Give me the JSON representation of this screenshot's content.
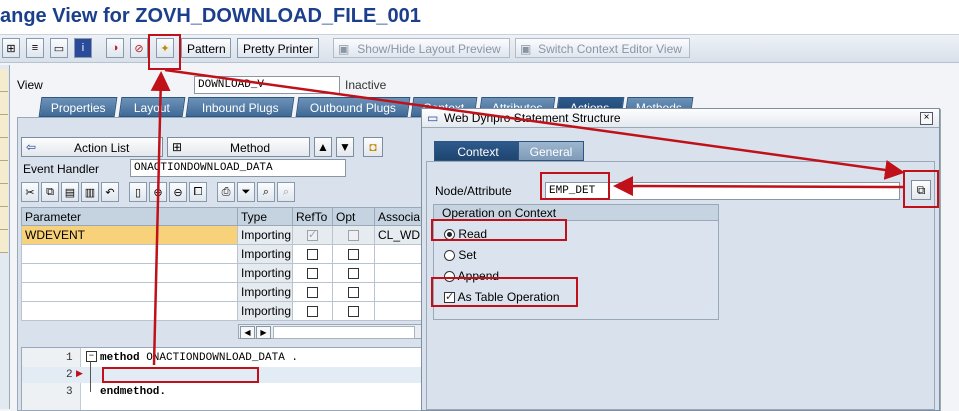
{
  "window_title": "ange View for ZOVH_DOWNLOAD_FILE_001",
  "toolbar": {
    "pattern": "Pattern",
    "pretty_printer": "Pretty Printer",
    "show_hide_layout": "Show/Hide Layout Preview",
    "switch_context": "Switch Context Editor View"
  },
  "view": {
    "label": "View",
    "value": "DOWNLOAD_V",
    "status": "Inactive"
  },
  "main_tabs": [
    "Properties",
    "Layout",
    "Inbound Plugs",
    "Outbound Plugs",
    "Context",
    "Attributes",
    "Actions",
    "Methods"
  ],
  "method_bar": {
    "action_list": "Action List",
    "method": "Method"
  },
  "event_handler": {
    "label": "Event Handler",
    "value": "ONACTIONDOWNLOAD_DATA"
  },
  "param_table": {
    "headers": [
      "Parameter",
      "Type",
      "RefTo",
      "Opt",
      "Associa"
    ],
    "rows": [
      {
        "parameter": "WDEVENT",
        "type": "Importing",
        "refto": true,
        "opt": false,
        "assoc": "CL_WD"
      },
      {
        "parameter": "",
        "type": "Importing",
        "refto": false,
        "opt": false,
        "assoc": ""
      },
      {
        "parameter": "",
        "type": "Importing",
        "refto": false,
        "opt": false,
        "assoc": ""
      },
      {
        "parameter": "",
        "type": "Importing",
        "refto": false,
        "opt": false,
        "assoc": ""
      },
      {
        "parameter": "",
        "type": "Importing",
        "refto": false,
        "opt": false,
        "assoc": ""
      }
    ]
  },
  "code": {
    "lines": [
      {
        "num": "1",
        "keyword": "method",
        "text": " ONACTIONDOWNLOAD_DATA ."
      },
      {
        "num": "2",
        "keyword": "",
        "text": ""
      },
      {
        "num": "3",
        "keyword": "endmethod.",
        "text": ""
      }
    ]
  },
  "dialog": {
    "title": "Web Dynpro Statement Structure",
    "tabs": [
      "Context",
      "General"
    ],
    "node_label": "Node/Attribute",
    "node_value": "EMP_DET",
    "group_title": "Operation on Context",
    "options": [
      "Read",
      "Set",
      "Append"
    ],
    "selected": "Read",
    "table_op_label": "As Table Operation",
    "table_op_checked": true
  },
  "colors": {
    "title": "#1b3f8b",
    "tab": "#3f6a97",
    "highlight": "#f7d27a",
    "annotation": "#c0101a"
  }
}
